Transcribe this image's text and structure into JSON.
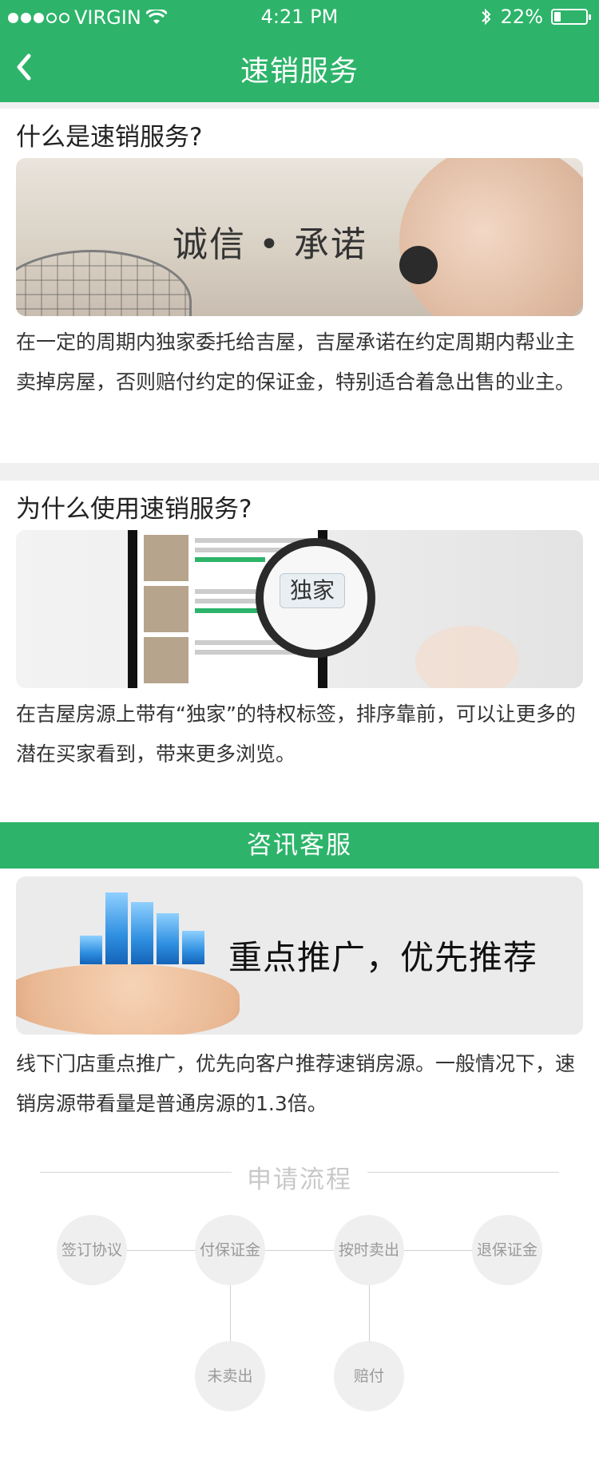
{
  "status_bar": {
    "carrier": "VIRGIN",
    "time": "4:21 PM",
    "battery": "22%",
    "battery_level": 0.22
  },
  "header": {
    "title": "速销服务"
  },
  "section1": {
    "title": "什么是速销服务?",
    "image_caption": "诚信 • 承诺",
    "text": "在一定的周期内独家委托给吉屋，吉屋承诺在约定周期内帮业主卖掉房屋，否则赔付约定的保证金，特别适合着急出售的业主。"
  },
  "section2": {
    "title": "为什么使用速销服务?",
    "image_tag": "独家",
    "text": "在吉屋房源上带有“独家”的特权标签，排序靠前，可以让更多的潜在买家看到，带来更多浏览。"
  },
  "section3": {
    "band_title": "咨讯客服",
    "image_caption": "重点推广，优先推荐",
    "text": "线下门店重点推广，优先向客户推荐速销房源。一般情况下，速销房源带看量是普通房源的1.3倍。"
  },
  "flow": {
    "title": "申请流程",
    "steps": [
      "签订协议",
      "付保证金",
      "按时卖出",
      "退保证金"
    ],
    "branches": [
      "未卖出",
      "赔付"
    ]
  },
  "colors": {
    "brand_green": "#2db46a",
    "divider_gray": "#f0f0f0"
  },
  "icons": [
    "signal-dots-icon",
    "wifi-icon",
    "bluetooth-icon",
    "battery-icon",
    "back-chevron-icon"
  ]
}
